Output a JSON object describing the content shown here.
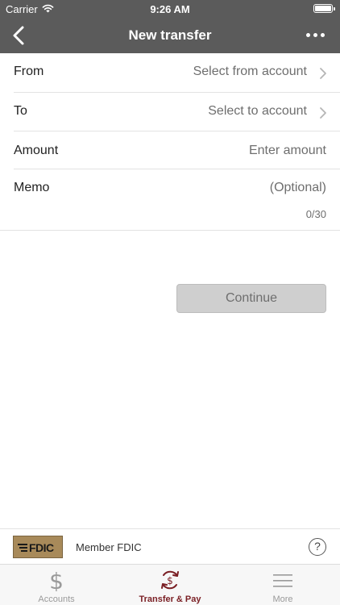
{
  "status_bar": {
    "carrier": "Carrier",
    "time": "9:26 AM"
  },
  "nav": {
    "title": "New transfer",
    "back_icon": "chevron-left-icon",
    "more_icon": "more-dots-icon"
  },
  "form": {
    "from": {
      "label": "From",
      "value": "Select from account"
    },
    "to": {
      "label": "To",
      "value": "Select to account"
    },
    "amount": {
      "label": "Amount",
      "placeholder": "Enter amount"
    },
    "memo": {
      "label": "Memo",
      "placeholder": "(Optional)",
      "counter": "0/30"
    }
  },
  "continue_label": "Continue",
  "fdic": {
    "logo_text": "FDIC",
    "member_text": "Member FDIC",
    "help_glyph": "?"
  },
  "tabs": [
    {
      "label": "Accounts",
      "icon": "dollar-icon",
      "active": false
    },
    {
      "label": "Transfer & Pay",
      "icon": "transfer-pay-icon",
      "active": true
    },
    {
      "label": "More",
      "icon": "menu-icon",
      "active": false
    }
  ],
  "colors": {
    "nav_bg": "#5b5b5b",
    "accent": "#7a1f24",
    "inactive": "#9a9a9a",
    "button_disabled": "#cfcfcf"
  }
}
